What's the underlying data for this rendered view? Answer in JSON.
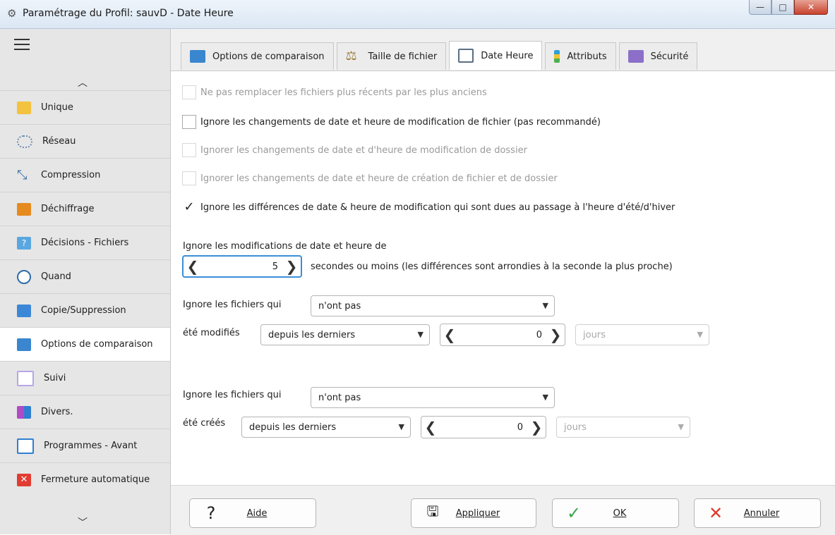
{
  "window": {
    "title": "Paramétrage du Profil: sauvD - Date Heure"
  },
  "sidebar": {
    "items": [
      {
        "label": "Unique",
        "color": "#f3c23e"
      },
      {
        "label": "Réseau",
        "color": "#6f8fb0"
      },
      {
        "label": "Compression",
        "color": "#3a6ea5"
      },
      {
        "label": "Déchiffrage",
        "color": "#e58a1e"
      },
      {
        "label": "Décisions - Fichiers",
        "color": "#5aa7e0"
      },
      {
        "label": "Quand",
        "color": "#2f6aa8"
      },
      {
        "label": "Copie/Suppression",
        "color": "#3d88d6"
      },
      {
        "label": "Options de comparaison",
        "color": "#3a86cf"
      },
      {
        "label": "Suivi",
        "color": "#b7a6e6"
      },
      {
        "label": "Divers.",
        "color": "#b04ac7"
      },
      {
        "label": "Programmes - Avant",
        "color": "#2f7fd1"
      },
      {
        "label": "Fermeture automatique",
        "color": "#e23c32"
      }
    ]
  },
  "tabs": [
    {
      "label": "Options de comparaison",
      "color": "#3a86cf"
    },
    {
      "label": "Taille de fichier",
      "color": "#9c7b3a"
    },
    {
      "label": "Date Heure",
      "color": "#5b6e84"
    },
    {
      "label": "Attributs",
      "color": "#2f9fd6"
    },
    {
      "label": "Sécurité",
      "color": "#8b6fc8"
    }
  ],
  "options": {
    "opt1": "Ne pas remplacer les fichiers plus récents par les plus anciens",
    "opt2": "Ignore les changements de date et heure de modification de fichier (pas recommandé)",
    "opt3": "Ignorer les changements de date et d'heure de modification de dossier",
    "opt4": "Ignorer les changements de date et heure de création de fichier et de dossier",
    "opt5": "Ignore les différences de date & heure de modification qui sont dues au passage à l'heure d'été/d'hiver",
    "opt5_checked": true
  },
  "tolerance": {
    "label": "Ignore les modifications de date et heure de",
    "value": "5",
    "suffix": "secondes ou moins (les différences sont arrondies à la seconde la plus proche)"
  },
  "modified": {
    "label": "Ignore les fichiers qui",
    "condition": "n'ont pas",
    "sub_label": "été modifiés",
    "period": "depuis les derniers",
    "count": "0",
    "unit": "jours"
  },
  "created": {
    "label": "Ignore les fichiers qui",
    "condition": "n'ont pas",
    "sub_label": "été créés",
    "period": "depuis les derniers",
    "count": "0",
    "unit": "jours"
  },
  "footer": {
    "help": "Aide",
    "apply": "Appliquer",
    "ok": "OK",
    "cancel": "Annuler"
  }
}
